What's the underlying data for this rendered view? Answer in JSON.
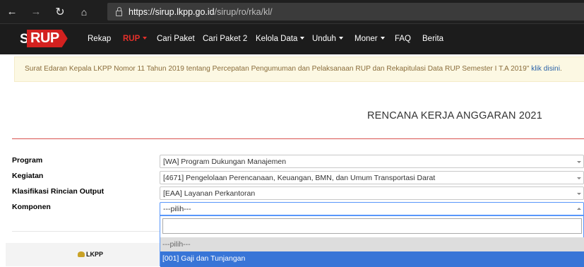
{
  "browser": {
    "url_host": "https://sirup.lkpp.go.id",
    "url_path": "/sirup/ro/rka/kl/",
    "icons": [
      "back-arrow-icon",
      "forward-arrow-icon",
      "refresh-icon",
      "home-icon",
      "lock-icon"
    ]
  },
  "navbar": {
    "logo_s": "S",
    "logo_rup": "RUP",
    "items": [
      {
        "label": "Rekap"
      },
      {
        "label": "RUP"
      },
      {
        "label": "Cari Paket"
      },
      {
        "label": "Cari Paket 2"
      },
      {
        "label": "Kelola Data"
      },
      {
        "label": "Unduh"
      },
      {
        "label": "Moner"
      },
      {
        "label": "FAQ"
      },
      {
        "label": "Berita"
      }
    ],
    "active_color": "#e4302b"
  },
  "notice": {
    "text": "Surat Edaran Kepala LKPP Nomor 11 Tahun 2019 tentang Percepatan Pengumuman dan Pelaksanaan RUP dan Rekapitulasi Data RUP Semester I T.A 2019\"",
    "link": "klik disini",
    "end": "."
  },
  "page": {
    "title": "RENCANA KERJA ANGGARAN 2021"
  },
  "form": {
    "program_label": "Program",
    "program_value": "[WA] Program Dukungan Manajemen",
    "kegiatan_label": "Kegiatan",
    "kegiatan_value": "[4671] Pengelolaan Perencanaan, Keuangan, BMN, dan Umum Transportasi Darat",
    "klasifikasi_label": "Klasifikasi Rincian Output",
    "klasifikasi_value": "[EAA] Layanan Perkantoran",
    "komponen_label": "Komponen",
    "komponen_value": "---pilih---"
  },
  "dropdown": {
    "search_value": "",
    "options": [
      {
        "label": "---pilih---",
        "state": "selected"
      },
      {
        "label": "[001] Gaji dan Tunjangan",
        "state": "highlighted"
      }
    ],
    "highlight_color": "#3875d7",
    "selected_bg": "#dddddd"
  },
  "footer": {
    "logo_text": "LKPP"
  }
}
